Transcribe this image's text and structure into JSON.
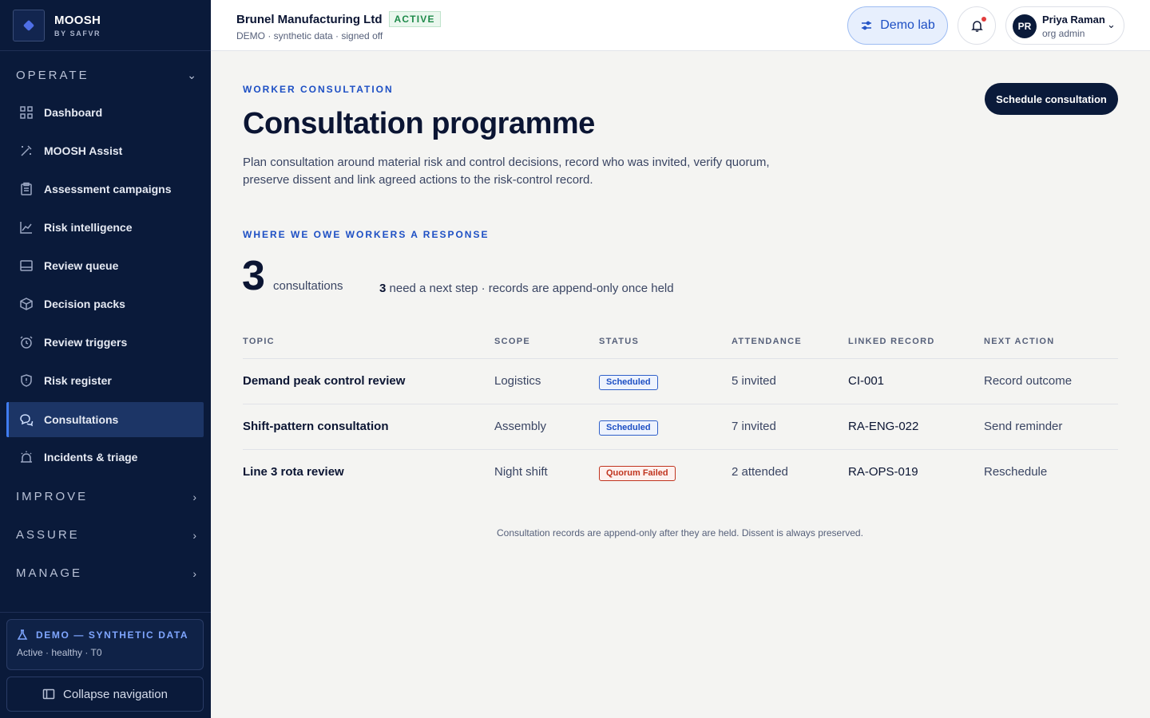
{
  "brand": {
    "name": "MOOSH",
    "sub": "BY SAFVR"
  },
  "sidebar": {
    "sections": {
      "operate": "OPERATE",
      "improve": "IMPROVE",
      "assure": "ASSURE",
      "manage": "MANAGE"
    },
    "items": [
      {
        "label": "Dashboard",
        "icon": "grid-icon"
      },
      {
        "label": "MOOSH Assist",
        "icon": "magic-wand-icon"
      },
      {
        "label": "Assessment campaigns",
        "icon": "clipboard-icon"
      },
      {
        "label": "Risk intelligence",
        "icon": "line-chart-icon"
      },
      {
        "label": "Review queue",
        "icon": "inbox-icon"
      },
      {
        "label": "Decision packs",
        "icon": "package-icon"
      },
      {
        "label": "Review triggers",
        "icon": "alarm-clock-icon"
      },
      {
        "label": "Risk register",
        "icon": "shield-icon"
      },
      {
        "label": "Consultations",
        "icon": "chat-bubbles-icon",
        "active": true
      },
      {
        "label": "Incidents & triage",
        "icon": "siren-icon"
      }
    ],
    "demo_card": {
      "title": "DEMO — SYNTHETIC DATA",
      "sub": "Active · healthy · T0"
    },
    "collapse_label": "Collapse navigation"
  },
  "header": {
    "org_name": "Brunel Manufacturing Ltd",
    "org_status": "ACTIVE",
    "org_sub": "DEMO · synthetic data · signed off",
    "demo_lab_label": "Demo lab",
    "user": {
      "initials": "PR",
      "name": "Priya Raman",
      "role": "org admin"
    }
  },
  "main": {
    "eyebrow": "WORKER CONSULTATION",
    "title": "Consultation programme",
    "description": "Plan consultation around material risk and control decisions, record who was invited, verify quorum, preserve dissent and link agreed actions to the risk-control record.",
    "schedule_button": "Schedule consultation",
    "stats_eyebrow": "WHERE WE OWE WORKERS A RESPONSE",
    "count": "3",
    "count_label": "consultations",
    "next_step_count": "3",
    "next_step_text": "need a next step · records are append-only once held",
    "table": {
      "headers": [
        "TOPIC",
        "SCOPE",
        "STATUS",
        "ATTENDANCE",
        "LINKED RECORD",
        "NEXT ACTION"
      ],
      "rows": [
        {
          "topic": "Demand peak control review",
          "scope": "Logistics",
          "status": "Scheduled",
          "attendance": "5 invited",
          "record": "CI-001",
          "action": "Record outcome"
        },
        {
          "topic": "Shift-pattern consultation",
          "scope": "Assembly",
          "status": "Scheduled",
          "attendance": "7 invited",
          "record": "RA-ENG-022",
          "action": "Send reminder"
        },
        {
          "topic": "Line 3 rota review",
          "scope": "Night shift",
          "status": "Quorum Failed",
          "attendance": "2 attended",
          "record": "RA-OPS-019",
          "action": "Reschedule"
        }
      ]
    },
    "footnote": "Consultation records are append-only after they are held. Dissent is always preserved."
  },
  "colors": {
    "sidebar_bg": "#0a1a3a",
    "accent": "#1d4fc4",
    "active_green": "#1e8a4a",
    "danger": "#c0341f"
  }
}
